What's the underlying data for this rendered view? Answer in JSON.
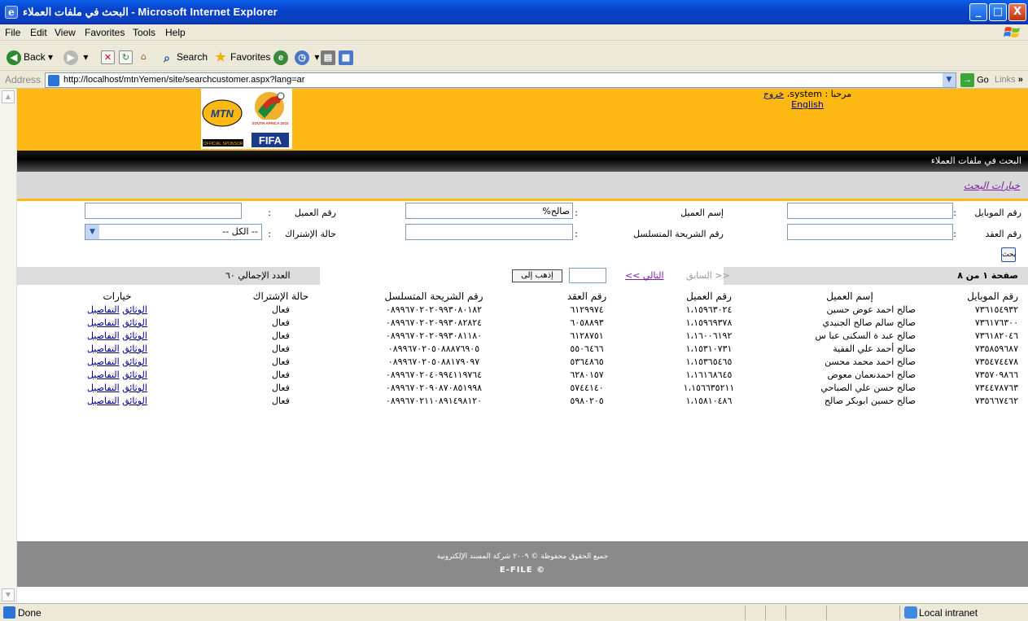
{
  "window": {
    "title": "البحث في ملفات العملاء - Microsoft Internet Explorer",
    "minimize": "_",
    "maximize": "□",
    "close": "X"
  },
  "menu": [
    "File",
    "Edit",
    "View",
    "Favorites",
    "Tools",
    "Help"
  ],
  "toolbar": {
    "back": "Back",
    "search": "Search",
    "favorites": "Favorites"
  },
  "address": {
    "label": "Address",
    "url": "http://localhost/mtnYemen/site/searchcustomer.aspx?lang=ar",
    "go": "Go",
    "links": "Links"
  },
  "header": {
    "welcome_text": "مرحبا : system،",
    "logout": "خروج",
    "language": "English",
    "logo_mtn": "MTN",
    "logo_sub": "OFFICIAL SPONSOR",
    "logo_fifa": "FIFA",
    "logo_event": "SOUTH AFRICA 2010"
  },
  "page": {
    "title": "البحث في ملفات العملاء",
    "search_options": "خيارات البحث"
  },
  "form": {
    "mobile_label": "رقم الموبايل",
    "mobile_value": "",
    "customer_name_label": "إسم العميل",
    "customer_name_value": "صالح%",
    "customer_no_label": "رقم العميل",
    "customer_no_value": "",
    "contract_label": "رقم العقد",
    "contract_value": "",
    "sim_serial_label": "رقم الشريحة المتسلسل",
    "sim_serial_value": "",
    "subscription_label": "حالة الإشتراك",
    "subscription_value": "-- الكل --",
    "colon": ":",
    "search_button": "بحث"
  },
  "pager": {
    "page_info": "صفحة ١ من ٨",
    "previous": "<< السابق",
    "next": "التالي >>",
    "go_button": "إذهب إلى",
    "page_input": "",
    "total": "العدد الإجمالي ٦٠"
  },
  "table": {
    "headers": [
      "رقم الموبايل",
      "إسم العميل",
      "رقم العميل",
      "رقم العقد",
      "رقم الشريحة المتسلسل",
      "حالة الإشتراك",
      "خيارات"
    ],
    "details_link": "التفاصيل",
    "docs_link": "الوثائق",
    "rows": [
      [
        "٧٣٦١٥٤٩٣٢",
        "صالح احمد عوض حسين",
        "١،١٥٩٦٣٠٢٤",
        "٦١٢٩٩٧٤",
        "٠٨٩٩٦٧٠٢٠٢٠٩٩٣٠٨٠١٨٢",
        "فعال"
      ],
      [
        "٧٣٦١٧٦٣٠٠",
        "صالح سالم صالح الجنيدي",
        "١،١٥٩٦٩٣٧٨",
        "٦٠٥٨٨٩٣",
        "٠٨٩٩٦٧٠٢٠٢٠٩٩٣٠٨٢٨٢٤",
        "فعال"
      ],
      [
        "٧٣٦١٨٢٠٤٦",
        "صالح عبد ة السكنى عبا س",
        "١،١٦٠٠٦١٩٢",
        "٦١٢٨٧٥١",
        "٠٨٩٩٦٧٠٢٠٢٠٩٩٣٠٨١١٨٠",
        "فعال"
      ],
      [
        "٧٣٥٨٥٩٦٨٧",
        "صالح أحمد علي الفقية",
        "١،١٥٣١٠٧٣١",
        "٥٥٠٦٤٦٦",
        "٠٨٩٩٦٧٠٢٠٥٠٨٨٨٧٦٩٠٥",
        "فعال"
      ],
      [
        "٧٣٥٤٧٤٤٧٨",
        "صالح احمد محمد محسن",
        "١،١٥٣٦٥٤٦٥",
        "٥٣٦٤٨٦٥",
        "٠٨٩٩٦٧٠٢٠٥٠٨٨١٧٩٠٩٧",
        "فعال"
      ],
      [
        "٧٣٥٧٠٩٨٦٦",
        "صالح احمدنعمان معوض",
        "١،١٦١٦٨٦٤٥",
        "٦٢٨٠١٥٧",
        "٠٨٩٩٦٧٠٢٠٤٠٩٩٤١١٩٧٦٤",
        "فعال"
      ],
      [
        "٧٣٤٤٧٨٧٦٣",
        "صالح حسن علي الصباحي",
        "١،١٥٦٦٣٥٢١١",
        "٥٧٤٤١٤٠",
        "٠٨٩٩٦٧٠٢٠٩٠٨٧٠٨٥١٩٩٨",
        "فعال"
      ],
      [
        "٧٣٥٦٦٧٤٦٢",
        "صالح حسين ابوبكر صالح",
        "١،١٥٨١٠٤٨٦",
        "٥٩٨٠٢٠٥",
        "٠٨٩٩٦٧٠٢١١٠٨٩١٤٩٨١٢٠",
        "فعال"
      ]
    ]
  },
  "footer": {
    "copyright": "جميع الحقوق محفوظة © ٢٠٠٩ شركة المسند الإلكترونية",
    "brand": "E-FILE ©"
  },
  "status": {
    "left": "Done",
    "zone": "Local intranet"
  }
}
